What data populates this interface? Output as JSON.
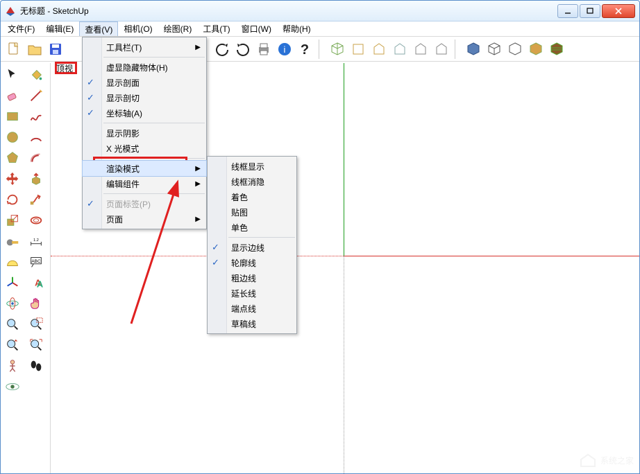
{
  "window": {
    "title": "无标题 - SketchUp"
  },
  "menubar": {
    "items": [
      {
        "label": "文件(F)"
      },
      {
        "label": "编辑(E)"
      },
      {
        "label": "查看(V)"
      },
      {
        "label": "相机(O)"
      },
      {
        "label": "绘图(R)"
      },
      {
        "label": "工具(T)"
      },
      {
        "label": "窗口(W)"
      },
      {
        "label": "帮助(H)"
      }
    ]
  },
  "view_menu": {
    "items": [
      {
        "label": "工具栏(T)",
        "sub": true
      },
      {
        "sep": true
      },
      {
        "label": "虚显隐藏物体(H)"
      },
      {
        "label": "显示剖面",
        "checked": true
      },
      {
        "label": "显示剖切",
        "checked": true
      },
      {
        "label": "坐标轴(A)",
        "checked": true
      },
      {
        "sep": true
      },
      {
        "label": "显示阴影"
      },
      {
        "label": "X 光模式"
      },
      {
        "sep": true
      },
      {
        "label": "渲染模式",
        "sub": true,
        "hover": true
      },
      {
        "label": "编辑组件",
        "sub": true
      },
      {
        "sep": true
      },
      {
        "label": "页面标签(P)",
        "disabled": true,
        "checked": true
      },
      {
        "label": "页面",
        "sub": true
      }
    ]
  },
  "render_submenu": {
    "items": [
      {
        "label": "线框显示"
      },
      {
        "label": "线框消隐"
      },
      {
        "label": "着色"
      },
      {
        "label": "贴图"
      },
      {
        "label": "单色"
      },
      {
        "sep": true
      },
      {
        "label": "显示边线",
        "checked": true
      },
      {
        "label": "轮廓线",
        "checked": true
      },
      {
        "label": "粗边线"
      },
      {
        "label": "延长线"
      },
      {
        "label": "端点线"
      },
      {
        "label": "草稿线"
      }
    ]
  },
  "annotations": {
    "top_view_label": "顶视"
  },
  "watermark": {
    "text": "系统之家"
  }
}
